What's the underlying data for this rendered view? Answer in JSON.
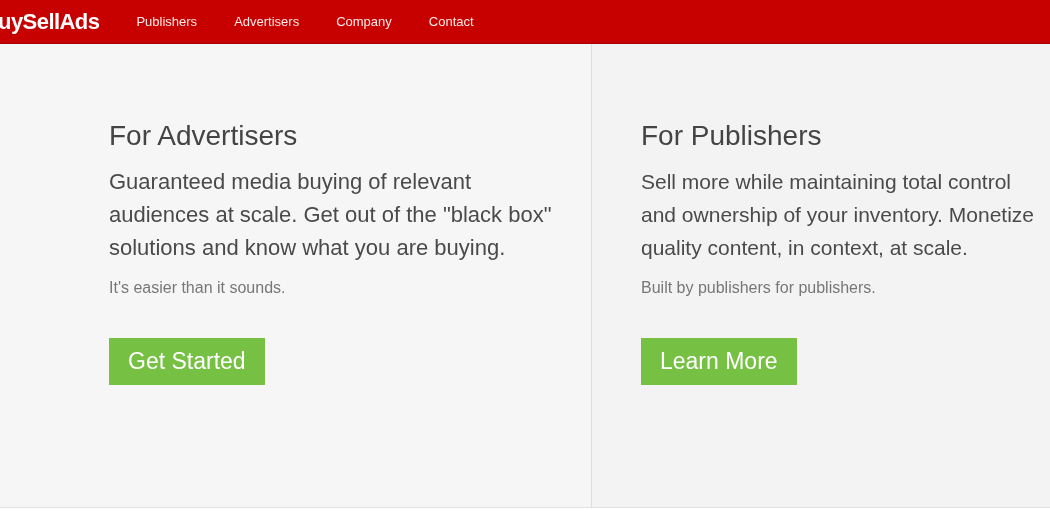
{
  "header": {
    "logo": "uySellAds",
    "nav": [
      {
        "label": "Publishers"
      },
      {
        "label": "Advertisers"
      },
      {
        "label": "Company"
      },
      {
        "label": "Contact"
      }
    ]
  },
  "panels": [
    {
      "title": "For Advertisers",
      "body": "Guaranteed media buying of relevant audiences at scale. Get out of the \"black box\" solutions and know what you are buying.",
      "note": "It's easier than it sounds.",
      "button": "Get Started"
    },
    {
      "title": "For Publishers",
      "body": "Sell more while maintaining total control and ownership of your inventory. Monetize quality content, in context, at scale.",
      "note": "Built by publishers for publishers.",
      "button": "Learn More"
    }
  ]
}
